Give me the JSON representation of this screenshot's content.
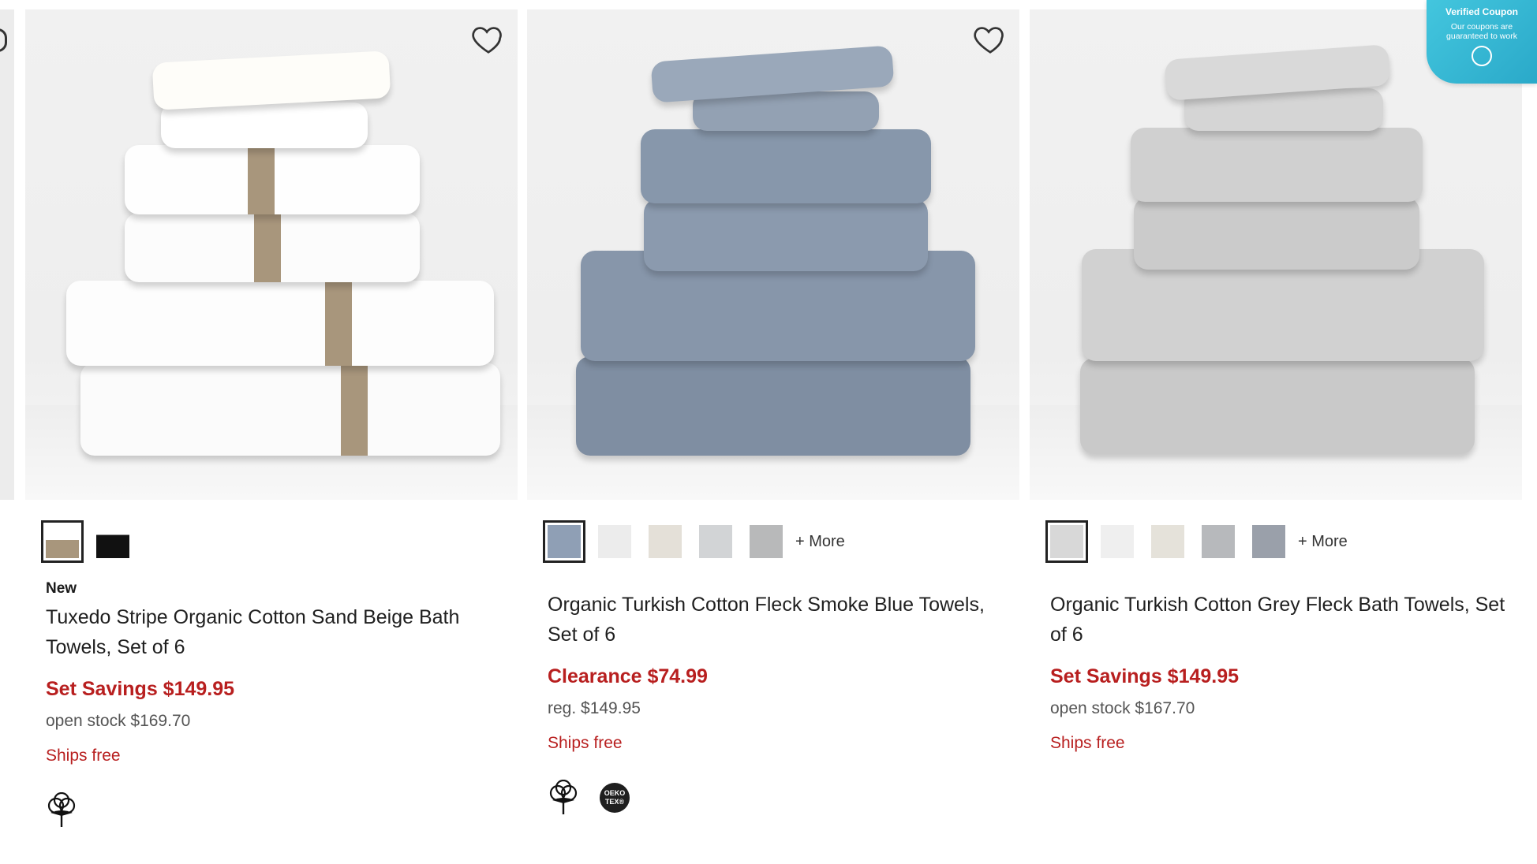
{
  "colors": {
    "accent": "#b81f1f",
    "coupon_bg": "#2fb3d0"
  },
  "coupon": {
    "title": "Verified Coupon",
    "line1": "Our coupons are",
    "line2": "guaranteed to work",
    "icon": "chat-icon"
  },
  "products": [
    {
      "badge": "New",
      "title": "Tuxedo Stripe Organic Cotton Sand Beige Bath Towels, Set of 6",
      "price_label": "Set Savings $149.95",
      "sub_label": "open stock $169.70",
      "shipping": "Ships free",
      "swatches": [
        "#a8967c",
        "#111111"
      ],
      "more": "",
      "feature_icons": [
        "organic-cotton-icon"
      ]
    },
    {
      "badge": "",
      "title": "Organic Turkish Cotton Fleck Smoke Blue Towels, Set of 6",
      "price_label": "Clearance $74.99",
      "sub_label": "reg. $149.95",
      "shipping": "Ships free",
      "swatches": [
        "#8f9fb5",
        "#ececec",
        "#e4e0d8",
        "#d2d4d6",
        "#b8b9ba"
      ],
      "more": "+ More",
      "feature_icons": [
        "organic-cotton-icon",
        "oeko-tex-icon"
      ],
      "oeko_text_1": "OEKO",
      "oeko_text_2": "TEX®"
    },
    {
      "badge": "",
      "title": "Organic Turkish Cotton Grey Fleck Bath Towels, Set of 6",
      "price_label": "Set Savings $149.95",
      "sub_label": "open stock $167.70",
      "shipping": "Ships free",
      "swatches": [
        "#d8d8d8",
        "#efefef",
        "#e5e2da",
        "#b7b9bc",
        "#9aa0aa"
      ],
      "more": "+ More",
      "feature_icons": []
    }
  ]
}
